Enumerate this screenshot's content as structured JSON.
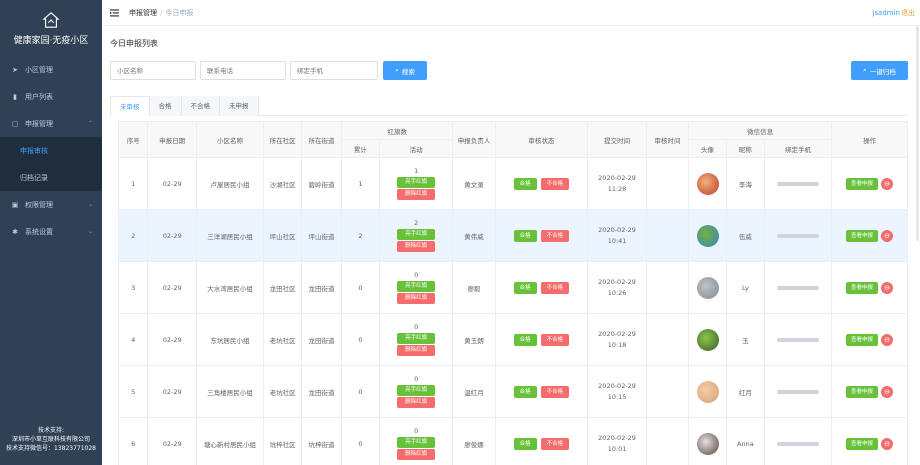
{
  "sidebar": {
    "title": "健康家园·无疫小区",
    "menu": [
      {
        "label": "小区管理",
        "icon": "send-icon",
        "symbol": "➤"
      },
      {
        "label": "用户列表",
        "icon": "bar-chart-icon",
        "symbol": "▮"
      },
      {
        "label": "申报管理",
        "icon": "list-icon",
        "symbol": "▢"
      }
    ],
    "submenu": [
      {
        "label": "申报审核",
        "active": true
      },
      {
        "label": "归档记录",
        "active": false
      }
    ],
    "menu2": [
      {
        "label": "权限管理",
        "icon": "lock-icon",
        "symbol": "▣"
      },
      {
        "label": "系统设置",
        "icon": "gear-icon",
        "symbol": "✱"
      }
    ],
    "support": {
      "line1": "技术支持:",
      "line2": "深圳市小草互联科技有限公司",
      "line3": "技术支持微信号：13823771028"
    }
  },
  "header": {
    "crumb_parent": "申报管理",
    "crumb_sep": "/",
    "crumb_current": "今日申报",
    "user": "jsadmin",
    "logout": "退出"
  },
  "page": {
    "title": "今日申报列表"
  },
  "filters": {
    "community_placeholder": "小区名称",
    "contact_placeholder": "联系电话",
    "phone_placeholder": "绑定手机",
    "search_label": "搜索",
    "archive_label": "一键归档"
  },
  "tabs": [
    "未审核",
    "合格",
    "不合格",
    "未申报"
  ],
  "table": {
    "headers": {
      "seq": "序号",
      "date": "申报日期",
      "community": "小区名称",
      "district": "所在社区",
      "street": "所在街道",
      "redcode": "红旗数",
      "total": "累计",
      "activity": "活动",
      "owner": "申报负责人",
      "review": "审核状态",
      "submit_time": "提交时间",
      "review_time": "审核时间",
      "wechat": "微信信息",
      "avatar": "头像",
      "nickname": "昵称",
      "bind_phone": "绑定手机",
      "ops": "操作"
    },
    "status_labels": {
      "pass": "合格",
      "fail": "不合格",
      "hand_red": "亮手红旗",
      "delete_red": "删除红旗",
      "view": "查看申报"
    },
    "rows": [
      {
        "seq": "1",
        "date": "02-29",
        "community": "卢屋居民小组",
        "district": "沙湖社区",
        "street": "碧岭街道",
        "total": "1",
        "activity": "1",
        "owner": "黄文录",
        "submit": "2020-02-29 11:28",
        "nickname": "李海"
      },
      {
        "seq": "2",
        "date": "02-29",
        "community": "三洋湖居民小组",
        "district": "坪山社区",
        "street": "坪山街道",
        "total": "2",
        "activity": "2",
        "owner": "黄伟威",
        "submit": "2020-02-29 10:41",
        "nickname": "伍威"
      },
      {
        "seq": "3",
        "date": "02-29",
        "community": "大水湾居民小组",
        "district": "龙田社区",
        "street": "龙田街道",
        "total": "0",
        "activity": "0",
        "owner": "廖毅",
        "submit": "2020-02-29 10:26",
        "nickname": "Ly"
      },
      {
        "seq": "4",
        "date": "02-29",
        "community": "东坑居民小组",
        "district": "老坑社区",
        "street": "龙田街道",
        "total": "0",
        "activity": "0",
        "owner": "黄玉朗",
        "submit": "2020-02-29 10:18",
        "nickname": "玉"
      },
      {
        "seq": "5",
        "date": "02-29",
        "community": "三角楼居民小组",
        "district": "老坑社区",
        "street": "龙田街道",
        "total": "0",
        "activity": "0",
        "owner": "温红月",
        "submit": "2020-02-29 10:15",
        "nickname": "红月"
      },
      {
        "seq": "6",
        "date": "02-29",
        "community": "塘心新村居民小组",
        "district": "坑梓社区",
        "street": "坑梓街道",
        "total": "0",
        "activity": "0",
        "owner": "廖俊娜",
        "submit": "2020-02-29 10:01",
        "nickname": "Anna"
      }
    ]
  },
  "colors": {
    "primary": "#409eff",
    "success": "#67c23a",
    "danger": "#f56c6c",
    "sidebar": "#304156"
  }
}
